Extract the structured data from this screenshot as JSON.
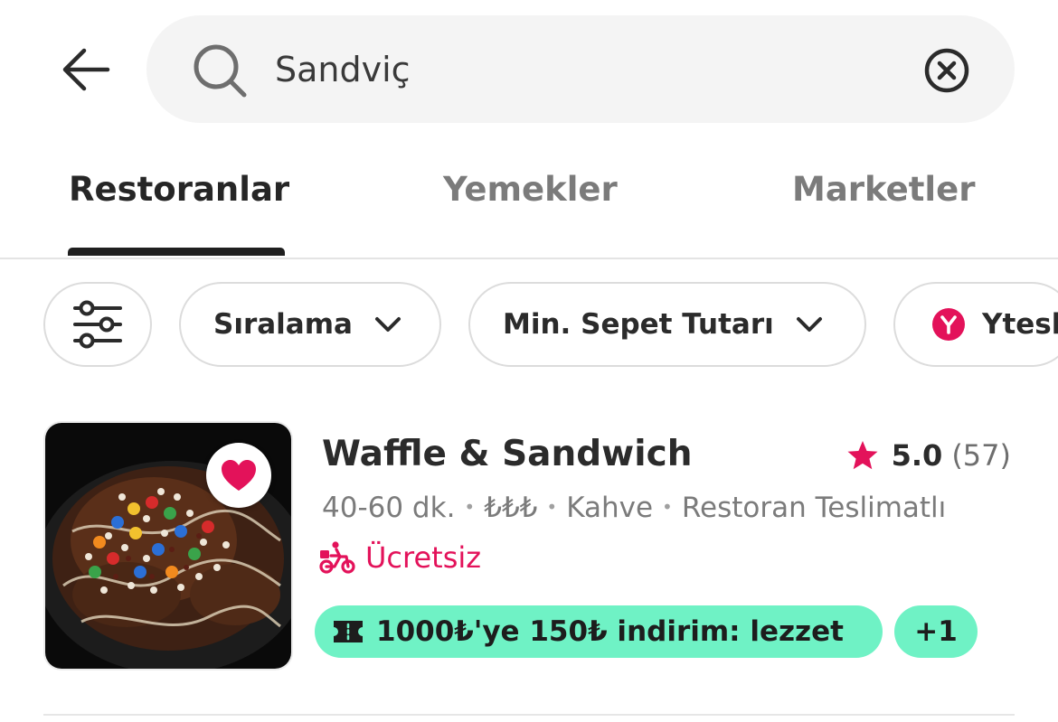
{
  "header": {
    "back_icon": "arrow-left-icon",
    "search": {
      "icon": "search-icon",
      "value": "Sandviç",
      "placeholder": "",
      "clear_icon": "clear-circle-x-icon"
    }
  },
  "tabs": [
    {
      "label": "Restoranlar",
      "active": true
    },
    {
      "label": "Yemekler",
      "active": false
    },
    {
      "label": "Marketler",
      "active": false
    }
  ],
  "filters": {
    "settings_icon": "sliders-icon",
    "chips": [
      {
        "label": "Sıralama",
        "icon": "chevron-down-icon"
      },
      {
        "label": "Min. Sepet Tutarı",
        "icon": "chevron-down-icon"
      },
      {
        "label": "Ytesl",
        "icon": "y-brand-icon"
      }
    ]
  },
  "restaurant": {
    "name": "Waffle & Sandwich",
    "rating": "5.0",
    "rating_count": "(57)",
    "delivery_time": "40-60 dk.",
    "price_level": "₺₺₺",
    "cuisine": "Kahve",
    "delivery_type": "Restoran Teslimatlı",
    "delivery_fee": "Ücretsiz",
    "promo": "1000₺'ye 150₺ indirim: lezzet",
    "more_promos": "+1",
    "favorited": true
  },
  "colors": {
    "brand_pink": "#e3125a",
    "promo_green": "#6ff2c5",
    "text_dark": "#2b2b2b",
    "text_muted": "#7b7b7b",
    "search_bg": "#f4f4f4"
  }
}
